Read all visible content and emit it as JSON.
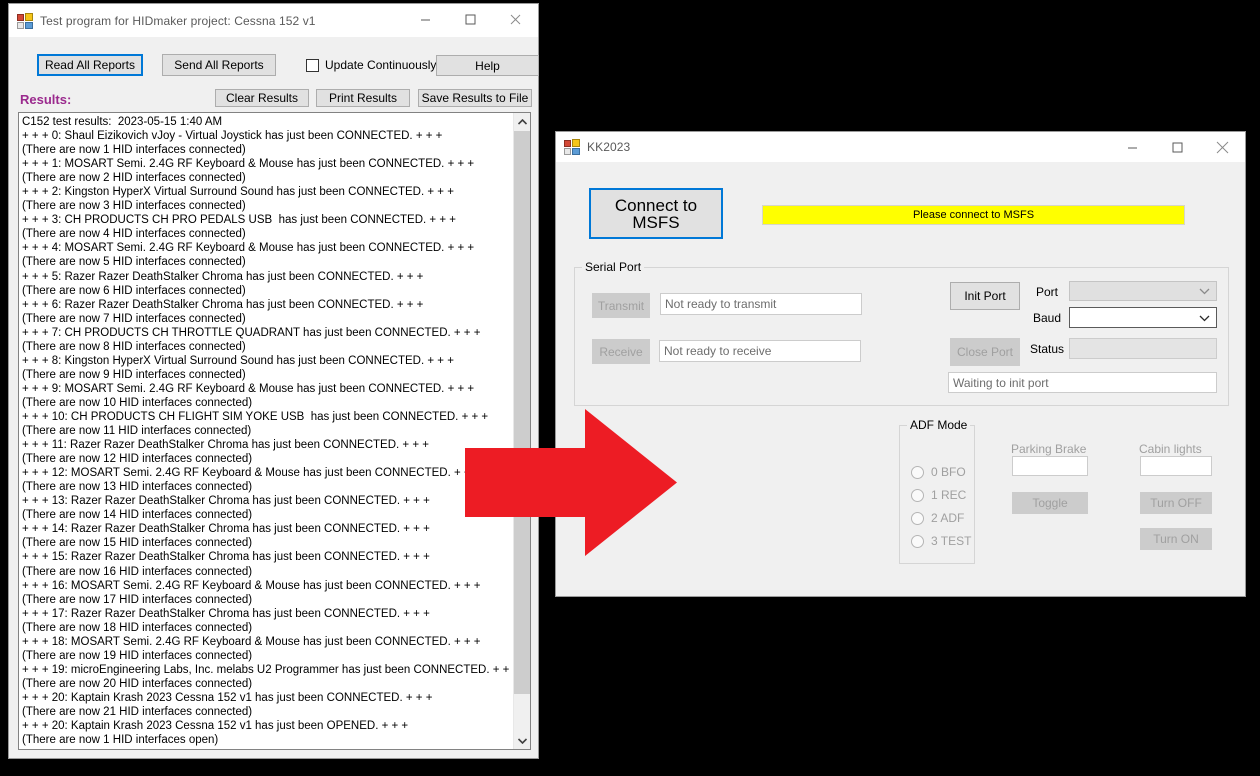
{
  "window1": {
    "title": "Test program for HIDmaker project: Cessna 152 v1",
    "icon": "app-icon",
    "caption": {
      "minimize": "minimize-icon",
      "maximize": "maximize-icon",
      "close": "close-icon"
    },
    "toolbar": {
      "read_all_reports": "Read All Reports",
      "send_all_reports": "Send All Reports",
      "update_continuously": "Update Continuously",
      "update_continuously_checked": false,
      "help": "Help",
      "clear_results": "Clear Results",
      "print_results": "Print Results",
      "save_results_to_file": "Save Results to File"
    },
    "results_label": "Results:",
    "results_label_color": "#9b2a8e",
    "results_text": "C152 test results:  2023-05-15 1:40 AM\n+ + + 0: Shaul Eizikovich vJoy - Virtual Joystick has just been CONNECTED. + + +\n(There are now 1 HID interfaces connected)\n+ + + 1: MOSART Semi. 2.4G RF Keyboard & Mouse has just been CONNECTED. + + +\n(There are now 2 HID interfaces connected)\n+ + + 2: Kingston HyperX Virtual Surround Sound has just been CONNECTED. + + +\n(There are now 3 HID interfaces connected)\n+ + + 3: CH PRODUCTS CH PRO PEDALS USB  has just been CONNECTED. + + +\n(There are now 4 HID interfaces connected)\n+ + + 4: MOSART Semi. 2.4G RF Keyboard & Mouse has just been CONNECTED. + + +\n(There are now 5 HID interfaces connected)\n+ + + 5: Razer Razer DeathStalker Chroma has just been CONNECTED. + + +\n(There are now 6 HID interfaces connected)\n+ + + 6: Razer Razer DeathStalker Chroma has just been CONNECTED. + + +\n(There are now 7 HID interfaces connected)\n+ + + 7: CH PRODUCTS CH THROTTLE QUADRANT has just been CONNECTED. + + +\n(There are now 8 HID interfaces connected)\n+ + + 8: Kingston HyperX Virtual Surround Sound has just been CONNECTED. + + +\n(There are now 9 HID interfaces connected)\n+ + + 9: MOSART Semi. 2.4G RF Keyboard & Mouse has just been CONNECTED. + + +\n(There are now 10 HID interfaces connected)\n+ + + 10: CH PRODUCTS CH FLIGHT SIM YOKE USB  has just been CONNECTED. + + +\n(There are now 11 HID interfaces connected)\n+ + + 11: Razer Razer DeathStalker Chroma has just been CONNECTED. + + +\n(There are now 12 HID interfaces connected)\n+ + + 12: MOSART Semi. 2.4G RF Keyboard & Mouse has just been CONNECTED. + + +\n(There are now 13 HID interfaces connected)\n+ + + 13: Razer Razer DeathStalker Chroma has just been CONNECTED. + + +\n(There are now 14 HID interfaces connected)\n+ + + 14: Razer Razer DeathStalker Chroma has just been CONNECTED. + + +\n(There are now 15 HID interfaces connected)\n+ + + 15: Razer Razer DeathStalker Chroma has just been CONNECTED. + + +\n(There are now 16 HID interfaces connected)\n+ + + 16: MOSART Semi. 2.4G RF Keyboard & Mouse has just been CONNECTED. + + +\n(There are now 17 HID interfaces connected)\n+ + + 17: Razer Razer DeathStalker Chroma has just been CONNECTED. + + +\n(There are now 18 HID interfaces connected)\n+ + + 18: MOSART Semi. 2.4G RF Keyboard & Mouse has just been CONNECTED. + + +\n(There are now 19 HID interfaces connected)\n+ + + 19: microEngineering Labs, Inc. melabs U2 Programmer has just been CONNECTED. + + +\n(There are now 20 HID interfaces connected)\n+ + + 20: Kaptain Krash 2023 Cessna 152 v1 has just been CONNECTED. + + +\n(There are now 21 HID interfaces connected)\n+ + + 20: Kaptain Krash 2023 Cessna 152 v1 has just been OPENED. + + +\n(There are now 1 HID interfaces open)",
    "scrollbar": {
      "up_arrow": "scroll-up-icon",
      "down_arrow": "scroll-down-icon"
    }
  },
  "window2": {
    "title": "KK2023",
    "icon": "app-icon",
    "caption": {
      "minimize": "minimize-icon",
      "maximize": "maximize-icon",
      "close": "close-icon"
    },
    "connect_button": "Connect to MSFS",
    "msfs_status": "Please connect to MSFS",
    "msfs_status_bg": "#ffff00",
    "serial_port": {
      "group_title": "Serial Port",
      "transmit_button": "Transmit",
      "transmit_status": "Not ready to transmit",
      "receive_button": "Receive",
      "receive_status": "Not ready to receive",
      "init_port_button": "Init Port",
      "close_port_button": "Close Port",
      "port_label": "Port",
      "port_value": "",
      "baud_label": "Baud",
      "baud_value": "",
      "status_label": "Status",
      "status_value": "",
      "port_message": "Waiting to init port"
    },
    "adf": {
      "group_title": "ADF Mode",
      "options": [
        {
          "label": "0 BFO",
          "selected": false
        },
        {
          "label": "1 REC",
          "selected": false
        },
        {
          "label": "2 ADF",
          "selected": false
        },
        {
          "label": "3 TEST",
          "selected": false
        }
      ]
    },
    "parking_brake": {
      "label": "Parking Brake",
      "value": "",
      "toggle_button": "Toggle"
    },
    "cabin_lights": {
      "label": "Cabin lights",
      "value": "",
      "turn_off_button": "Turn OFF",
      "turn_on_button": "Turn ON"
    }
  },
  "annotation": {
    "arrow": "red-right-arrow",
    "arrow_color": "#ED1C24"
  },
  "desktop": {
    "background_color": "#000000"
  }
}
